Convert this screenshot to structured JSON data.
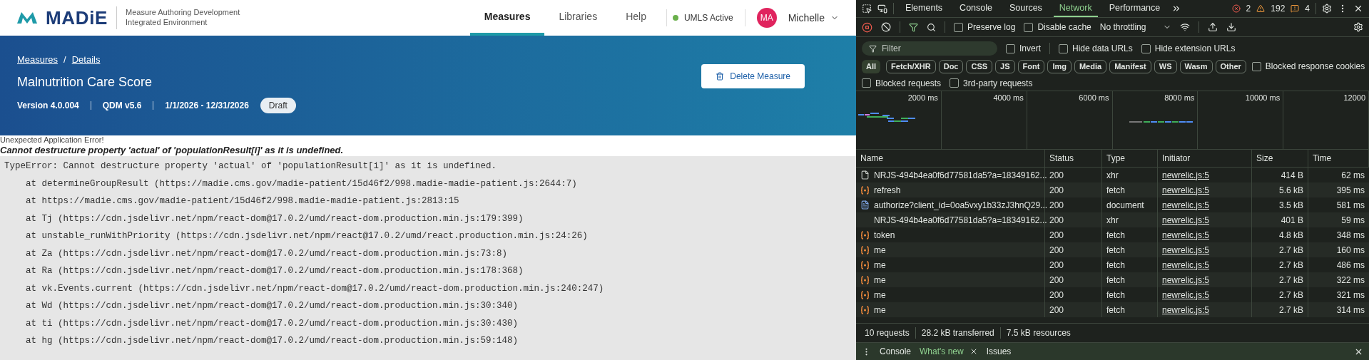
{
  "header": {
    "logo_text": "MADiE",
    "subtitle": [
      "Measure Authoring Development",
      "Integrated Environment"
    ],
    "nav": [
      {
        "label": "Measures",
        "selected": true
      },
      {
        "label": "Libraries",
        "selected": false
      },
      {
        "label": "Help",
        "selected": false
      }
    ],
    "status": {
      "label": "UMLS Active",
      "on": true
    },
    "user": {
      "initials": "MA",
      "name": "Michelle"
    }
  },
  "banner": {
    "breadcrumbs": [
      "Measures",
      "Details"
    ],
    "separator": "/",
    "title": "Malnutrition Care Score",
    "meta": [
      "Version 4.0.004",
      "QDM v5.6",
      "1/1/2026 - 12/31/2026"
    ],
    "badge": "Draft",
    "delete_button": "Delete Measure"
  },
  "error": {
    "heading": "Unexpected Application Error!",
    "message": "Cannot destructure property 'actual' of 'populationResult[i]' as it is undefined.",
    "stack": [
      "TypeError: Cannot destructure property 'actual' of 'populationResult[i]' as it is undefined.",
      "    at determineGroupResult (https://madie.cms.gov/madie-patient/15d46f2/998.madie-madie-patient.js:2644:7)",
      "    at https://madie.cms.gov/madie-patient/15d46f2/998.madie-madie-patient.js:2813:15",
      "    at Tj (https://cdn.jsdelivr.net/npm/react-dom@17.0.2/umd/react-dom.production.min.js:179:399)",
      "    at unstable_runWithPriority (https://cdn.jsdelivr.net/npm/react@17.0.2/umd/react.production.min.js:24:26)",
      "    at Za (https://cdn.jsdelivr.net/npm/react-dom@17.0.2/umd/react-dom.production.min.js:73:8)",
      "    at Ra (https://cdn.jsdelivr.net/npm/react-dom@17.0.2/umd/react-dom.production.min.js:178:368)",
      "    at vk.Events.current (https://cdn.jsdelivr.net/npm/react-dom@17.0.2/umd/react-dom.production.min.js:240:247)",
      "    at Wd (https://cdn.jsdelivr.net/npm/react-dom@17.0.2/umd/react-dom.production.min.js:30:340)",
      "    at ti (https://cdn.jsdelivr.net/npm/react-dom@17.0.2/umd/react-dom.production.min.js:30:430)",
      "    at hg (https://cdn.jsdelivr.net/npm/react-dom@17.0.2/umd/react-dom.production.min.js:59:148)"
    ]
  },
  "devtools": {
    "tabs": [
      {
        "label": "Elements",
        "selected": false
      },
      {
        "label": "Console",
        "selected": false
      },
      {
        "label": "Sources",
        "selected": false
      },
      {
        "label": "Network",
        "selected": true
      },
      {
        "label": "Performance",
        "selected": false
      }
    ],
    "counts": {
      "errors": "2",
      "warnings": "192",
      "issues": "4"
    },
    "recording": true,
    "toolbar_checks": [
      {
        "label": "Preserve log",
        "checked": false
      },
      {
        "label": "Disable cache",
        "checked": false
      }
    ],
    "throttling": "No throttling",
    "filter": {
      "placeholder": "Filter"
    },
    "filter_checks": [
      {
        "label": "Invert",
        "checked": false
      },
      {
        "label": "Hide data URLs",
        "checked": false
      },
      {
        "label": "Hide extension URLs",
        "checked": false
      }
    ],
    "chips": [
      {
        "label": "All",
        "selected": true
      },
      {
        "label": "Fetch/XHR",
        "selected": false
      },
      {
        "label": "Doc",
        "selected": false
      },
      {
        "label": "CSS",
        "selected": false
      },
      {
        "label": "JS",
        "selected": false
      },
      {
        "label": "Font",
        "selected": false
      },
      {
        "label": "Img",
        "selected": false
      },
      {
        "label": "Media",
        "selected": false
      },
      {
        "label": "Manifest",
        "selected": false
      },
      {
        "label": "WS",
        "selected": false
      },
      {
        "label": "Wasm",
        "selected": false
      },
      {
        "label": "Other",
        "selected": false
      }
    ],
    "chip_checks": [
      {
        "label": "Blocked response cookies",
        "checked": false
      }
    ],
    "extra_checks": [
      {
        "label": "Blocked requests",
        "checked": false
      },
      {
        "label": "3rd-party requests",
        "checked": false
      }
    ],
    "overview_ticks": [
      "2000 ms",
      "4000 ms",
      "6000 ms",
      "8000 ms",
      "10000 ms",
      "12000"
    ],
    "columns": [
      "Name",
      "Status",
      "Type",
      "Initiator",
      "Size",
      "Time"
    ],
    "rows": [
      {
        "kind": "file",
        "name": "NRJS-494b4ea0f6d77581da5?a=18349162...",
        "status": "200",
        "type": "xhr",
        "initiator": "newrelic.js:5",
        "size": "414 B",
        "time": "62 ms"
      },
      {
        "kind": "fetch",
        "name": "refresh",
        "status": "200",
        "type": "fetch",
        "initiator": "newrelic.js:5",
        "size": "5.6 kB",
        "time": "395 ms"
      },
      {
        "kind": "document",
        "name": "authorize?client_id=0oa5vxy1b33zJ3hnQ29...",
        "status": "200",
        "type": "document",
        "initiator": "newrelic.js:5",
        "size": "3.5 kB",
        "time": "581 ms"
      },
      {
        "kind": "none",
        "name": "NRJS-494b4ea0f6d77581da5?a=18349162...",
        "status": "200",
        "type": "xhr",
        "initiator": "newrelic.js:5",
        "size": "401 B",
        "time": "59 ms"
      },
      {
        "kind": "fetch",
        "name": "token",
        "status": "200",
        "type": "fetch",
        "initiator": "newrelic.js:5",
        "size": "4.8 kB",
        "time": "348 ms"
      },
      {
        "kind": "fetch",
        "name": "me",
        "status": "200",
        "type": "fetch",
        "initiator": "newrelic.js:5",
        "size": "2.7 kB",
        "time": "160 ms"
      },
      {
        "kind": "fetch",
        "name": "me",
        "status": "200",
        "type": "fetch",
        "initiator": "newrelic.js:5",
        "size": "2.7 kB",
        "time": "486 ms"
      },
      {
        "kind": "fetch",
        "name": "me",
        "status": "200",
        "type": "fetch",
        "initiator": "newrelic.js:5",
        "size": "2.7 kB",
        "time": "322 ms"
      },
      {
        "kind": "fetch",
        "name": "me",
        "status": "200",
        "type": "fetch",
        "initiator": "newrelic.js:5",
        "size": "2.7 kB",
        "time": "321 ms"
      },
      {
        "kind": "fetch",
        "name": "me",
        "status": "200",
        "type": "fetch",
        "initiator": "newrelic.js:5",
        "size": "2.7 kB",
        "time": "314 ms"
      }
    ],
    "summary": [
      "10 requests",
      "28.2 kB transferred",
      "7.5 kB resources"
    ],
    "drawer_tabs": [
      {
        "label": "Console",
        "selected": false,
        "closable": false
      },
      {
        "label": "What's new",
        "selected": true,
        "closable": true
      },
      {
        "label": "Issues",
        "selected": false,
        "closable": false
      }
    ]
  }
}
